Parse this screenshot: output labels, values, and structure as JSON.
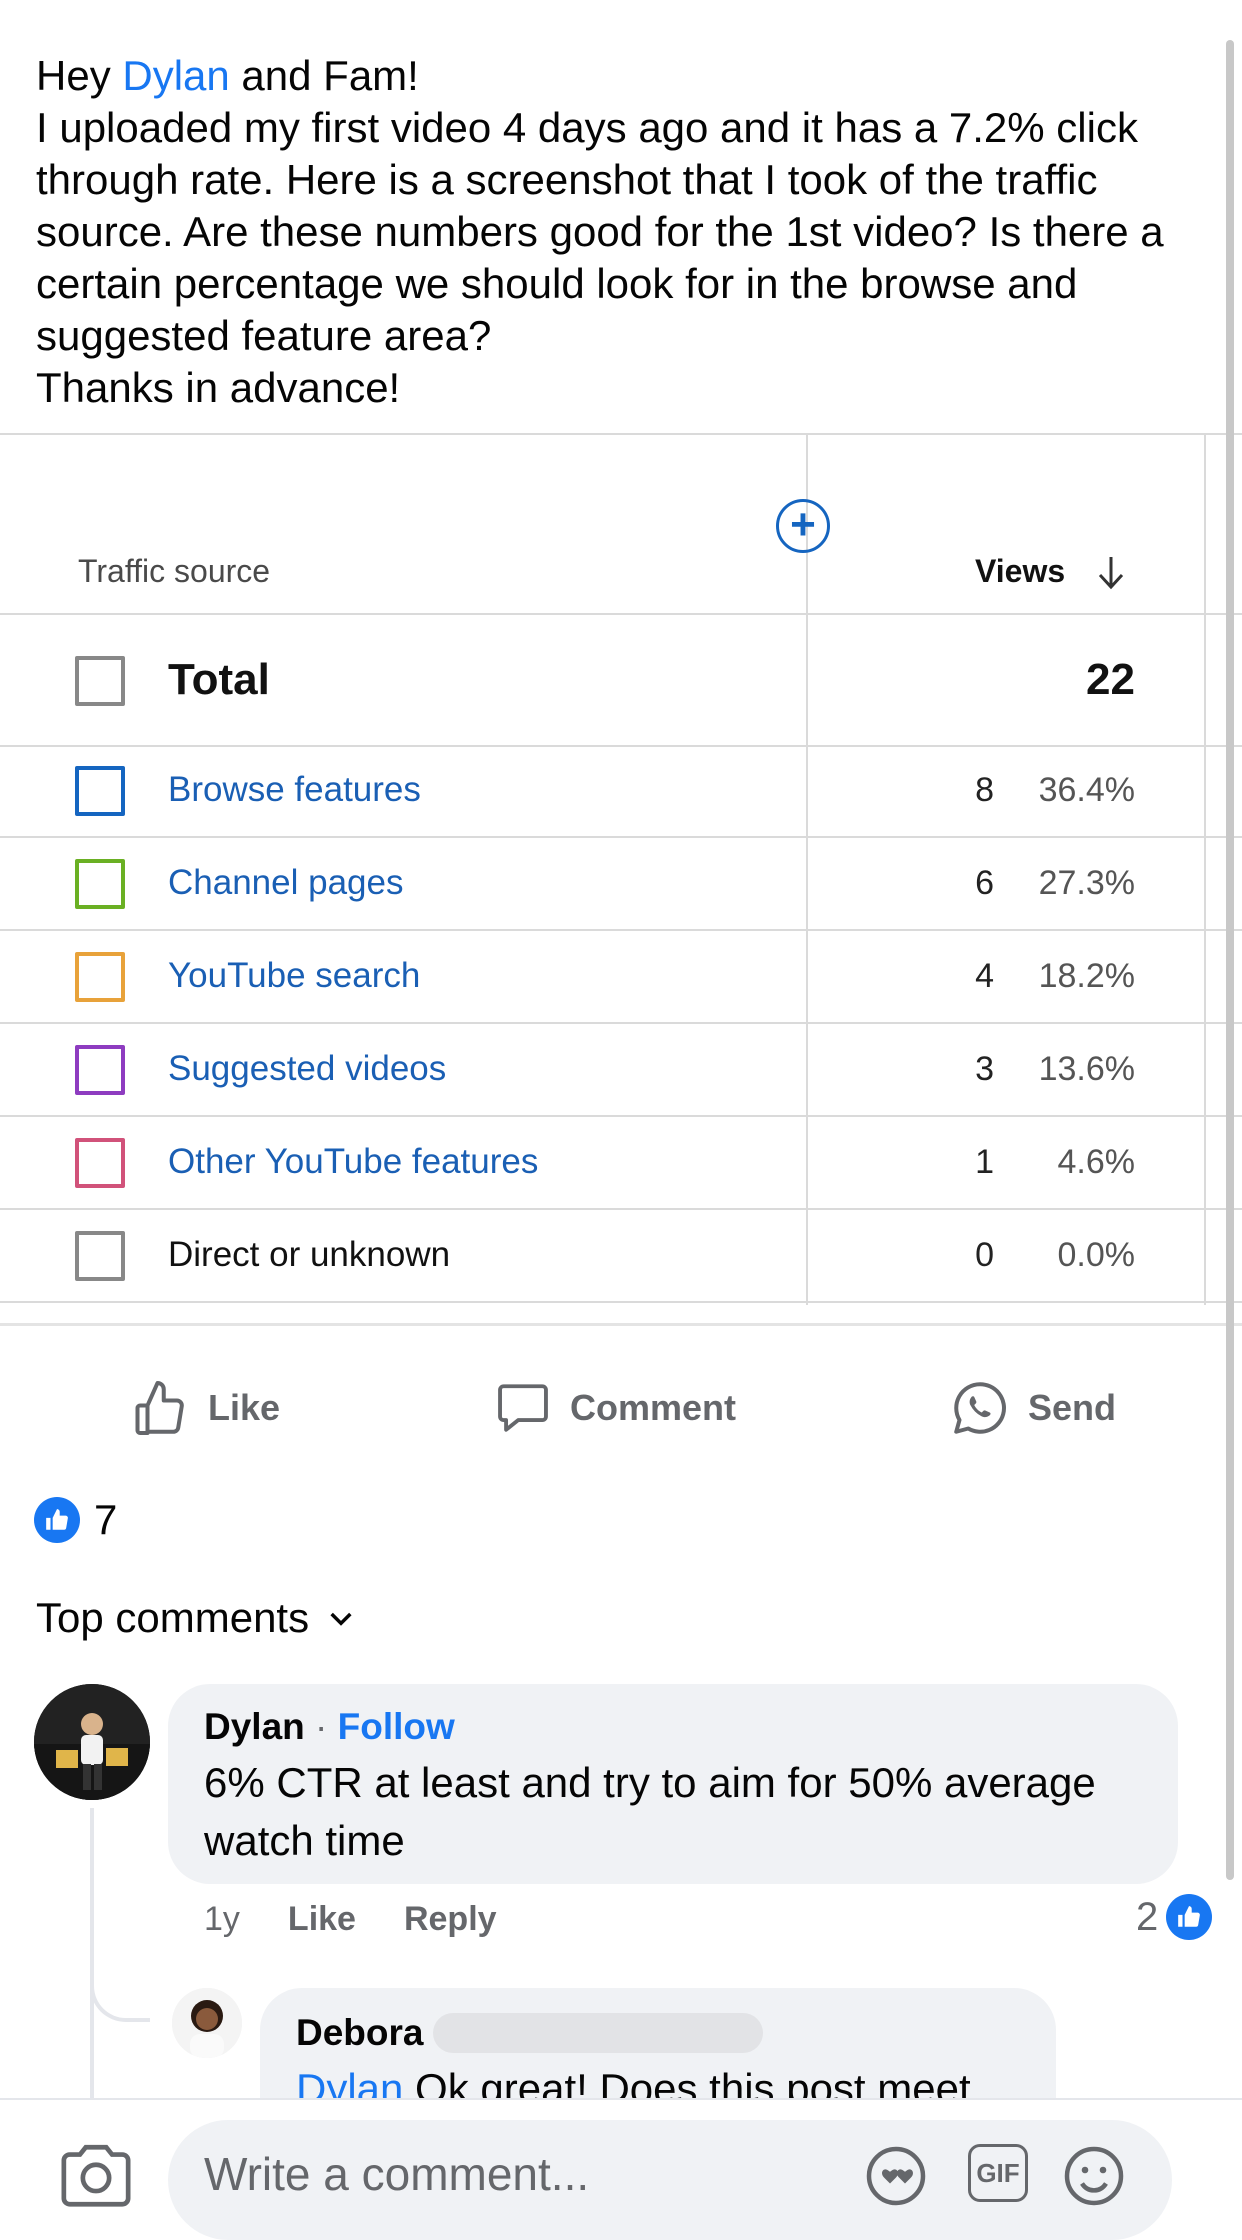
{
  "post": {
    "greeting_prefix": "Hey ",
    "mention": "Dylan",
    "greeting_suffix": " and Fam!",
    "line2": "I uploaded my first video 4 days ago and it has a 7.2% click through rate. Here is a screenshot that I took of the traffic source.  Are these numbers good for the 1st video?  Is there a certain percentage we should look for in the browse and suggested feature area?",
    "line3": "Thanks in advance!"
  },
  "table": {
    "header_source": "Traffic source",
    "header_views": "Views",
    "total_label": "Total",
    "total_value": "22",
    "rows": [
      {
        "source": "Browse features",
        "views": "8",
        "percent": "36.4%",
        "color": "#1565c0"
      },
      {
        "source": "Channel pages",
        "views": "6",
        "percent": "27.3%",
        "color": "#6ab023"
      },
      {
        "source": "YouTube search",
        "views": "4",
        "percent": "18.2%",
        "color": "#e8a23a"
      },
      {
        "source": "Suggested videos",
        "views": "3",
        "percent": "13.6%",
        "color": "#8e3cc0"
      },
      {
        "source": "Other YouTube features",
        "views": "1",
        "percent": "4.6%",
        "color": "#d1527a"
      },
      {
        "source": "Direct or unknown",
        "views": "0",
        "percent": "0.0%",
        "color": "#888888"
      }
    ]
  },
  "actions": {
    "like": "Like",
    "comment": "Comment",
    "send": "Send"
  },
  "reactions": {
    "count": "7"
  },
  "comments_header": "Top comments",
  "comments": [
    {
      "author": "Dylan",
      "follow": "Follow",
      "text": "6% CTR at least and try to aim for 50% average watch time",
      "time": "1y",
      "like": "Like",
      "reply": "Reply",
      "reactions": "2"
    },
    {
      "author": "Debora",
      "mention": "Dylan",
      "text": " Ok great!  Does this post meet"
    }
  ],
  "composer": {
    "placeholder": "Write a comment..."
  }
}
